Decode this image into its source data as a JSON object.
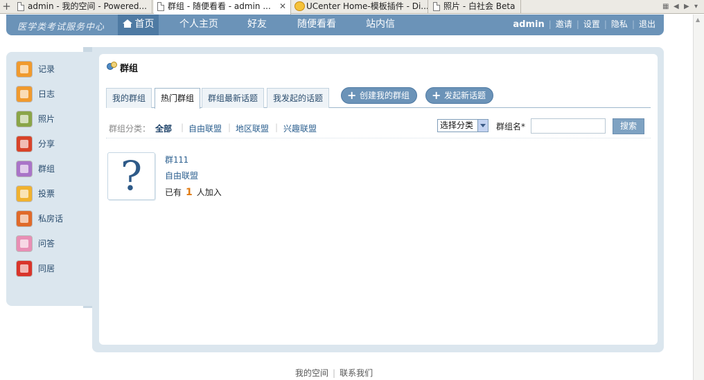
{
  "browser": {
    "tabs": [
      {
        "title": "admin - 我的空间 - Powered...",
        "icon": "document-icon",
        "active": false
      },
      {
        "title": "群组 - 随便看看 - admin ...",
        "icon": "document-icon",
        "active": true
      },
      {
        "title": "UCenter Home-模板插件 - Di...",
        "icon": "ucenter-icon",
        "active": false
      },
      {
        "title": "照片 - 白社会 Beta",
        "icon": "document-icon",
        "active": false
      }
    ],
    "close_glyph": "✕",
    "new_tab_glyph": "+",
    "ctl_grid": "▦",
    "ctl_prev": "◀",
    "ctl_next": "▶",
    "ctl_down": "▾"
  },
  "nav": {
    "logo": "医学类考试服务中心",
    "items": [
      "首页",
      "个人主页",
      "好友",
      "随便看看",
      "站内信"
    ],
    "active_index": 0,
    "user": "admin",
    "links": [
      "邀请",
      "设置",
      "隐私",
      "退出"
    ],
    "link_sep": "|"
  },
  "sidebar": {
    "items": [
      {
        "label": "记录",
        "icon": "notepad-icon",
        "color": "#f09a2e"
      },
      {
        "label": "日志",
        "icon": "journal-icon",
        "color": "#f09a2e"
      },
      {
        "label": "照片",
        "icon": "photo-icon",
        "color": "#8aa548"
      },
      {
        "label": "分享",
        "icon": "heart-icon",
        "color": "#d8432a"
      },
      {
        "label": "群组",
        "icon": "gift-icon",
        "color": "#a974c8"
      },
      {
        "label": "投票",
        "icon": "chart-icon",
        "color": "#f0b230"
      },
      {
        "label": "私房话",
        "icon": "owl-icon",
        "color": "#e06a2a"
      },
      {
        "label": "问答",
        "icon": "letter-icon",
        "color": "#e88fb5"
      },
      {
        "label": "同居",
        "icon": "dice-icon",
        "color": "#d9352b"
      }
    ]
  },
  "page": {
    "title": "群组",
    "tabs": [
      "我的群组",
      "热门群组",
      "群组最新话题",
      "我发起的话题"
    ],
    "active_tab": 1,
    "actions": [
      "创建我的群组",
      "发起新话题"
    ],
    "plus_glyph": "+"
  },
  "filter": {
    "label": "群组分类：",
    "categories": [
      "全部",
      "自由联盟",
      "地区联盟",
      "兴趣联盟"
    ],
    "active_index": 0,
    "sep": "|",
    "select_value": "选择分类",
    "name_label": "群组名*",
    "name_value": "",
    "search_label": "搜索"
  },
  "groups": [
    {
      "name": "群111",
      "category": "自由联盟",
      "count_prefix": "已有",
      "count": "1",
      "count_suffix": "人加入",
      "thumb_glyph": "?"
    }
  ],
  "footer": {
    "links": [
      "我的空间",
      "联系我们"
    ],
    "sep": "|"
  }
}
